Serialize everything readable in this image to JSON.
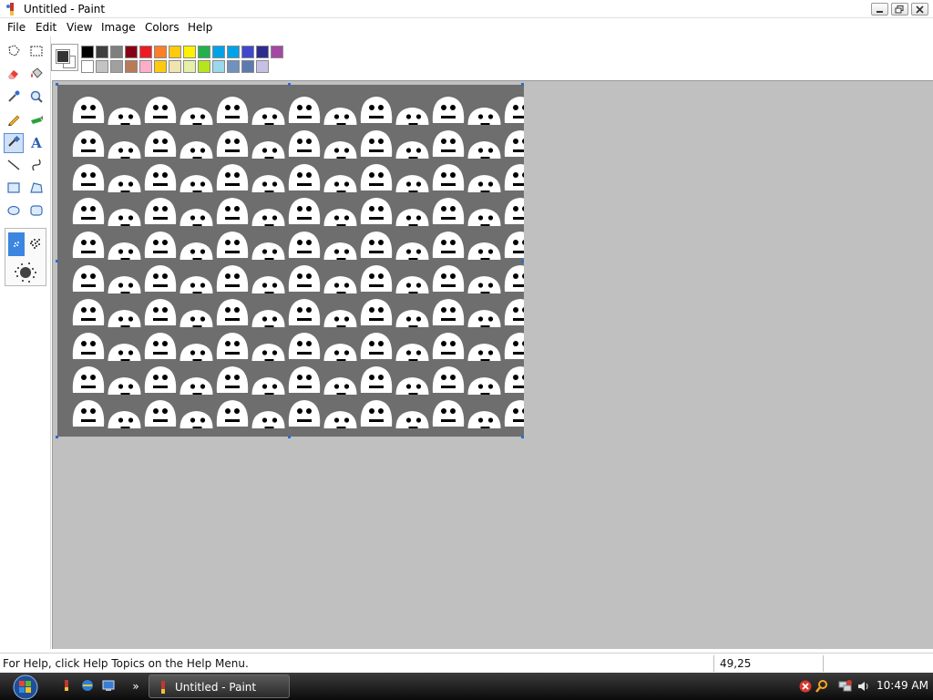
{
  "window": {
    "title": "Untitled - Paint"
  },
  "menu": [
    "File",
    "Edit",
    "View",
    "Image",
    "Colors",
    "Help"
  ],
  "tools": [
    {
      "name": "free-select",
      "icon": "free-form-select-icon"
    },
    {
      "name": "rect-select",
      "icon": "rect-select-icon"
    },
    {
      "name": "eraser",
      "icon": "eraser-icon"
    },
    {
      "name": "fill",
      "icon": "fill-bucket-icon"
    },
    {
      "name": "color-picker",
      "icon": "eyedropper-icon"
    },
    {
      "name": "magnifier",
      "icon": "magnifier-icon"
    },
    {
      "name": "pencil",
      "icon": "pencil-icon"
    },
    {
      "name": "brush",
      "icon": "brush-icon"
    },
    {
      "name": "airbrush",
      "icon": "airbrush-icon",
      "selected": true
    },
    {
      "name": "text",
      "icon": "text-icon",
      "glyph": "A"
    },
    {
      "name": "line",
      "icon": "line-icon"
    },
    {
      "name": "curve",
      "icon": "curve-icon"
    },
    {
      "name": "rectangle",
      "icon": "rectangle-icon"
    },
    {
      "name": "polygon",
      "icon": "polygon-icon"
    },
    {
      "name": "ellipse",
      "icon": "ellipse-icon"
    },
    {
      "name": "rounded-rectangle",
      "icon": "rounded-rectangle-icon"
    }
  ],
  "colors": {
    "foreground": "#333333",
    "background": "#ffffff",
    "palette_top": [
      "#000000",
      "#404040",
      "#7f7f7f",
      "#880015",
      "#ed1c24",
      "#ff7f27",
      "#ffc90e",
      "#fff200",
      "#22b14c",
      "#00a2e8",
      "#00a2e8",
      "#3f48cc",
      "#2d2d8f",
      "#a349a4"
    ],
    "palette_bottom": [
      "#ffffff",
      "#c3c3c3",
      "#a0a0a0",
      "#b97a57",
      "#ffaec9",
      "#ffc90e",
      "#efe4b0",
      "#e6f0a8",
      "#b5e61d",
      "#99d9ea",
      "#7092be",
      "#5b7bb0",
      "#c8bfe7"
    ]
  },
  "status": {
    "help_text": "For Help, click Help Topics on the Help Menu.",
    "coords": "49,25"
  },
  "taskbar": {
    "task_label": "Untitled - Paint",
    "clock": "10:49 AM",
    "accent": "#1f4f9a"
  }
}
